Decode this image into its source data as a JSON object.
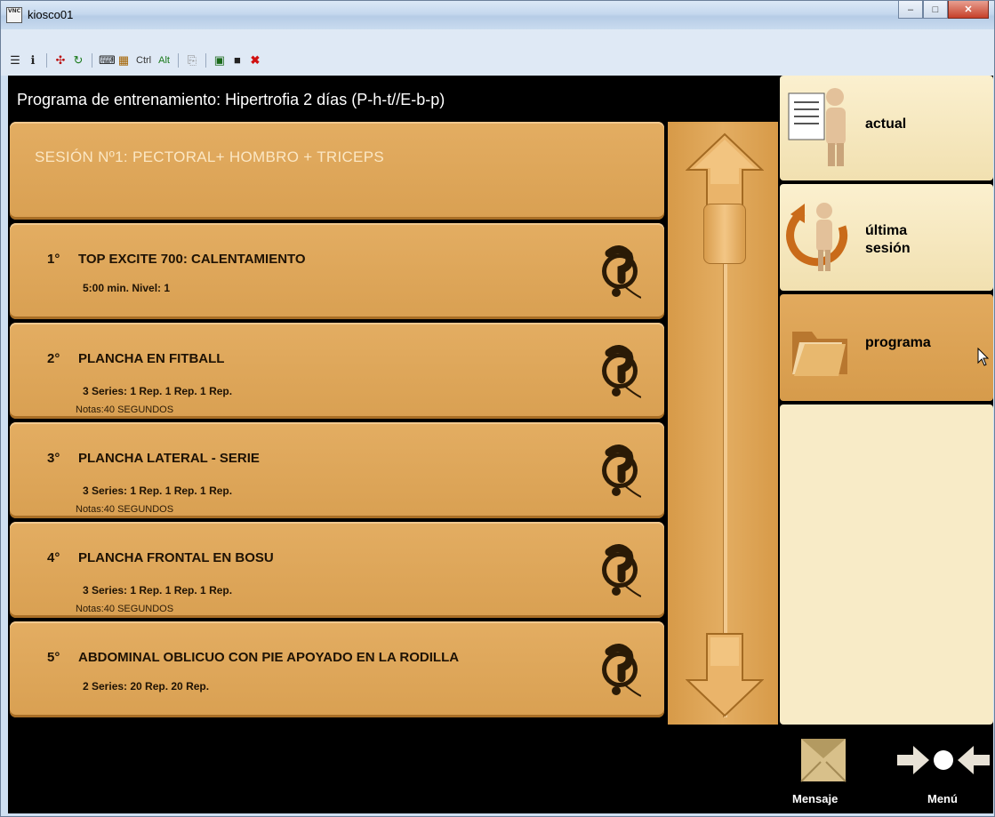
{
  "window": {
    "title": "kiosco01"
  },
  "toolbar": {
    "ctrl_label": "Ctrl",
    "alt_label": "Alt"
  },
  "header": {
    "title": "Programa de entrenamiento: Hipertrofia 2 días (P-h-t//E-b-p)"
  },
  "session": {
    "title": "SESIÓN Nº1:  PECTORAL+ HOMBRO + TRICEPS"
  },
  "exercises": [
    {
      "num": "1°",
      "name": "TOP EXCITE 700: CALENTAMIENTO",
      "detail": "5:00 min. Nivel: 1",
      "notes": ""
    },
    {
      "num": "2°",
      "name": "PLANCHA EN FITBALL",
      "detail": "3 Series:  1 Rep.  1 Rep.  1 Rep.",
      "notes": "Notas:40 SEGUNDOS"
    },
    {
      "num": "3°",
      "name": "PLANCHA LATERAL - SERIE",
      "detail": "3 Series:  1 Rep.  1 Rep.  1 Rep.",
      "notes": "Notas:40 SEGUNDOS"
    },
    {
      "num": "4°",
      "name": "PLANCHA FRONTAL EN BOSU",
      "detail": "3 Series:  1 Rep.  1 Rep.  1 Rep.",
      "notes": "Notas:40 SEGUNDOS"
    },
    {
      "num": "5°",
      "name": "ABDOMINAL OBLICUO CON PIE APOYADO EN LA RODILLA",
      "detail": "2 Series:  20 Rep.  20 Rep.",
      "notes": ""
    }
  ],
  "side": {
    "actual": "actual",
    "ultima_1": "última",
    "ultima_2": "sesión",
    "programa": "programa"
  },
  "footer": {
    "mensaje": "Mensaje",
    "menu": "Menú"
  },
  "colors": {
    "card": "#dfa65a",
    "accent_light": "#f8ebc7",
    "background": "#000000",
    "titlebar": "#c5d8ee"
  }
}
